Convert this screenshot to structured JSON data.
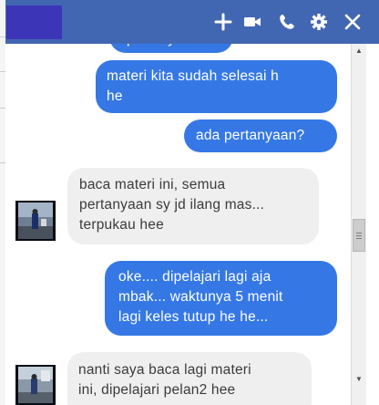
{
  "header": {
    "icons": [
      "add-icon",
      "video-camera-icon",
      "phone-icon",
      "gear-icon",
      "close-icon"
    ],
    "color": "#4267b2"
  },
  "messages": [
    {
      "direction": "outgoing",
      "text": "pertanyaan?"
    },
    {
      "direction": "outgoing",
      "text": "materi kita sudah selesai h\nhe"
    },
    {
      "direction": "outgoing",
      "text": "ada pertanyaan?"
    },
    {
      "direction": "incoming",
      "text": "baca materi ini, semua\npertanyaan sy jd ilang mas...\nterpukau hee"
    },
    {
      "direction": "outgoing",
      "text": "oke.... dipelajari lagi aja\nmbak... waktunya 5 menit\nlagi keles tutup he he..."
    },
    {
      "direction": "incoming",
      "text": "nanti saya baca lagi materi\nini, dipelajari pelan2 hee"
    }
  ],
  "colors": {
    "outgoing_bubble": "#3578e5",
    "incoming_bubble": "#efefef"
  }
}
